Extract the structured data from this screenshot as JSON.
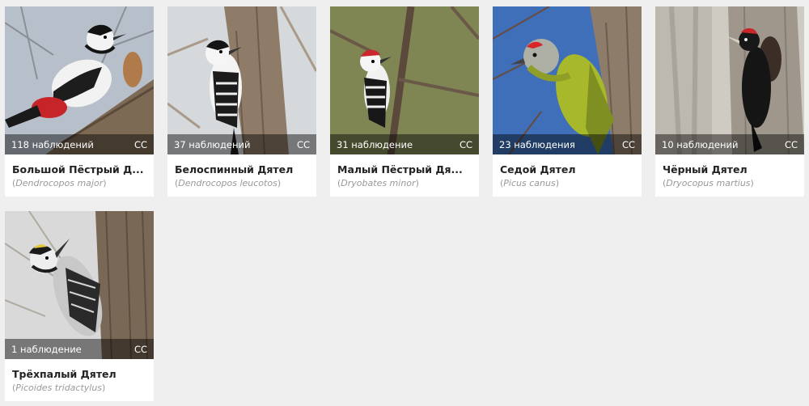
{
  "cards": [
    {
      "count": "118 наблюдений",
      "license": "CC",
      "name": "Большой Пёстрый Д...",
      "latin_open": "(",
      "latin": "Dendrocopos major",
      "latin_close": ")"
    },
    {
      "count": "37 наблюдений",
      "license": "CC",
      "name": "Белоспинный Дятел",
      "latin_open": "(",
      "latin": "Dendrocopos leucotos",
      "latin_close": ")"
    },
    {
      "count": "31 наблюдение",
      "license": "CC",
      "name": "Малый Пёстрый Дя...",
      "latin_open": "(",
      "latin": "Dryobates minor",
      "latin_close": ")"
    },
    {
      "count": "23 наблюдения",
      "license": "CC",
      "name": "Седой Дятел",
      "latin_open": "(",
      "latin": "Picus canus",
      "latin_close": ")"
    },
    {
      "count": "10 наблюдений",
      "license": "CC",
      "name": "Чёрный Дятел",
      "latin_open": "(",
      "latin": "Dryocopus martius",
      "latin_close": ")"
    },
    {
      "count": "1 наблюдение",
      "license": "CC",
      "name": "Трёхпалый Дятел",
      "latin_open": "(",
      "latin": "Picoides tridactylus",
      "latin_close": ")"
    }
  ],
  "colors": {
    "page_background": "#efefef",
    "card_background": "#ffffff",
    "overlay": "rgba(0,0,0,0.45)",
    "latin_text": "#999999"
  }
}
